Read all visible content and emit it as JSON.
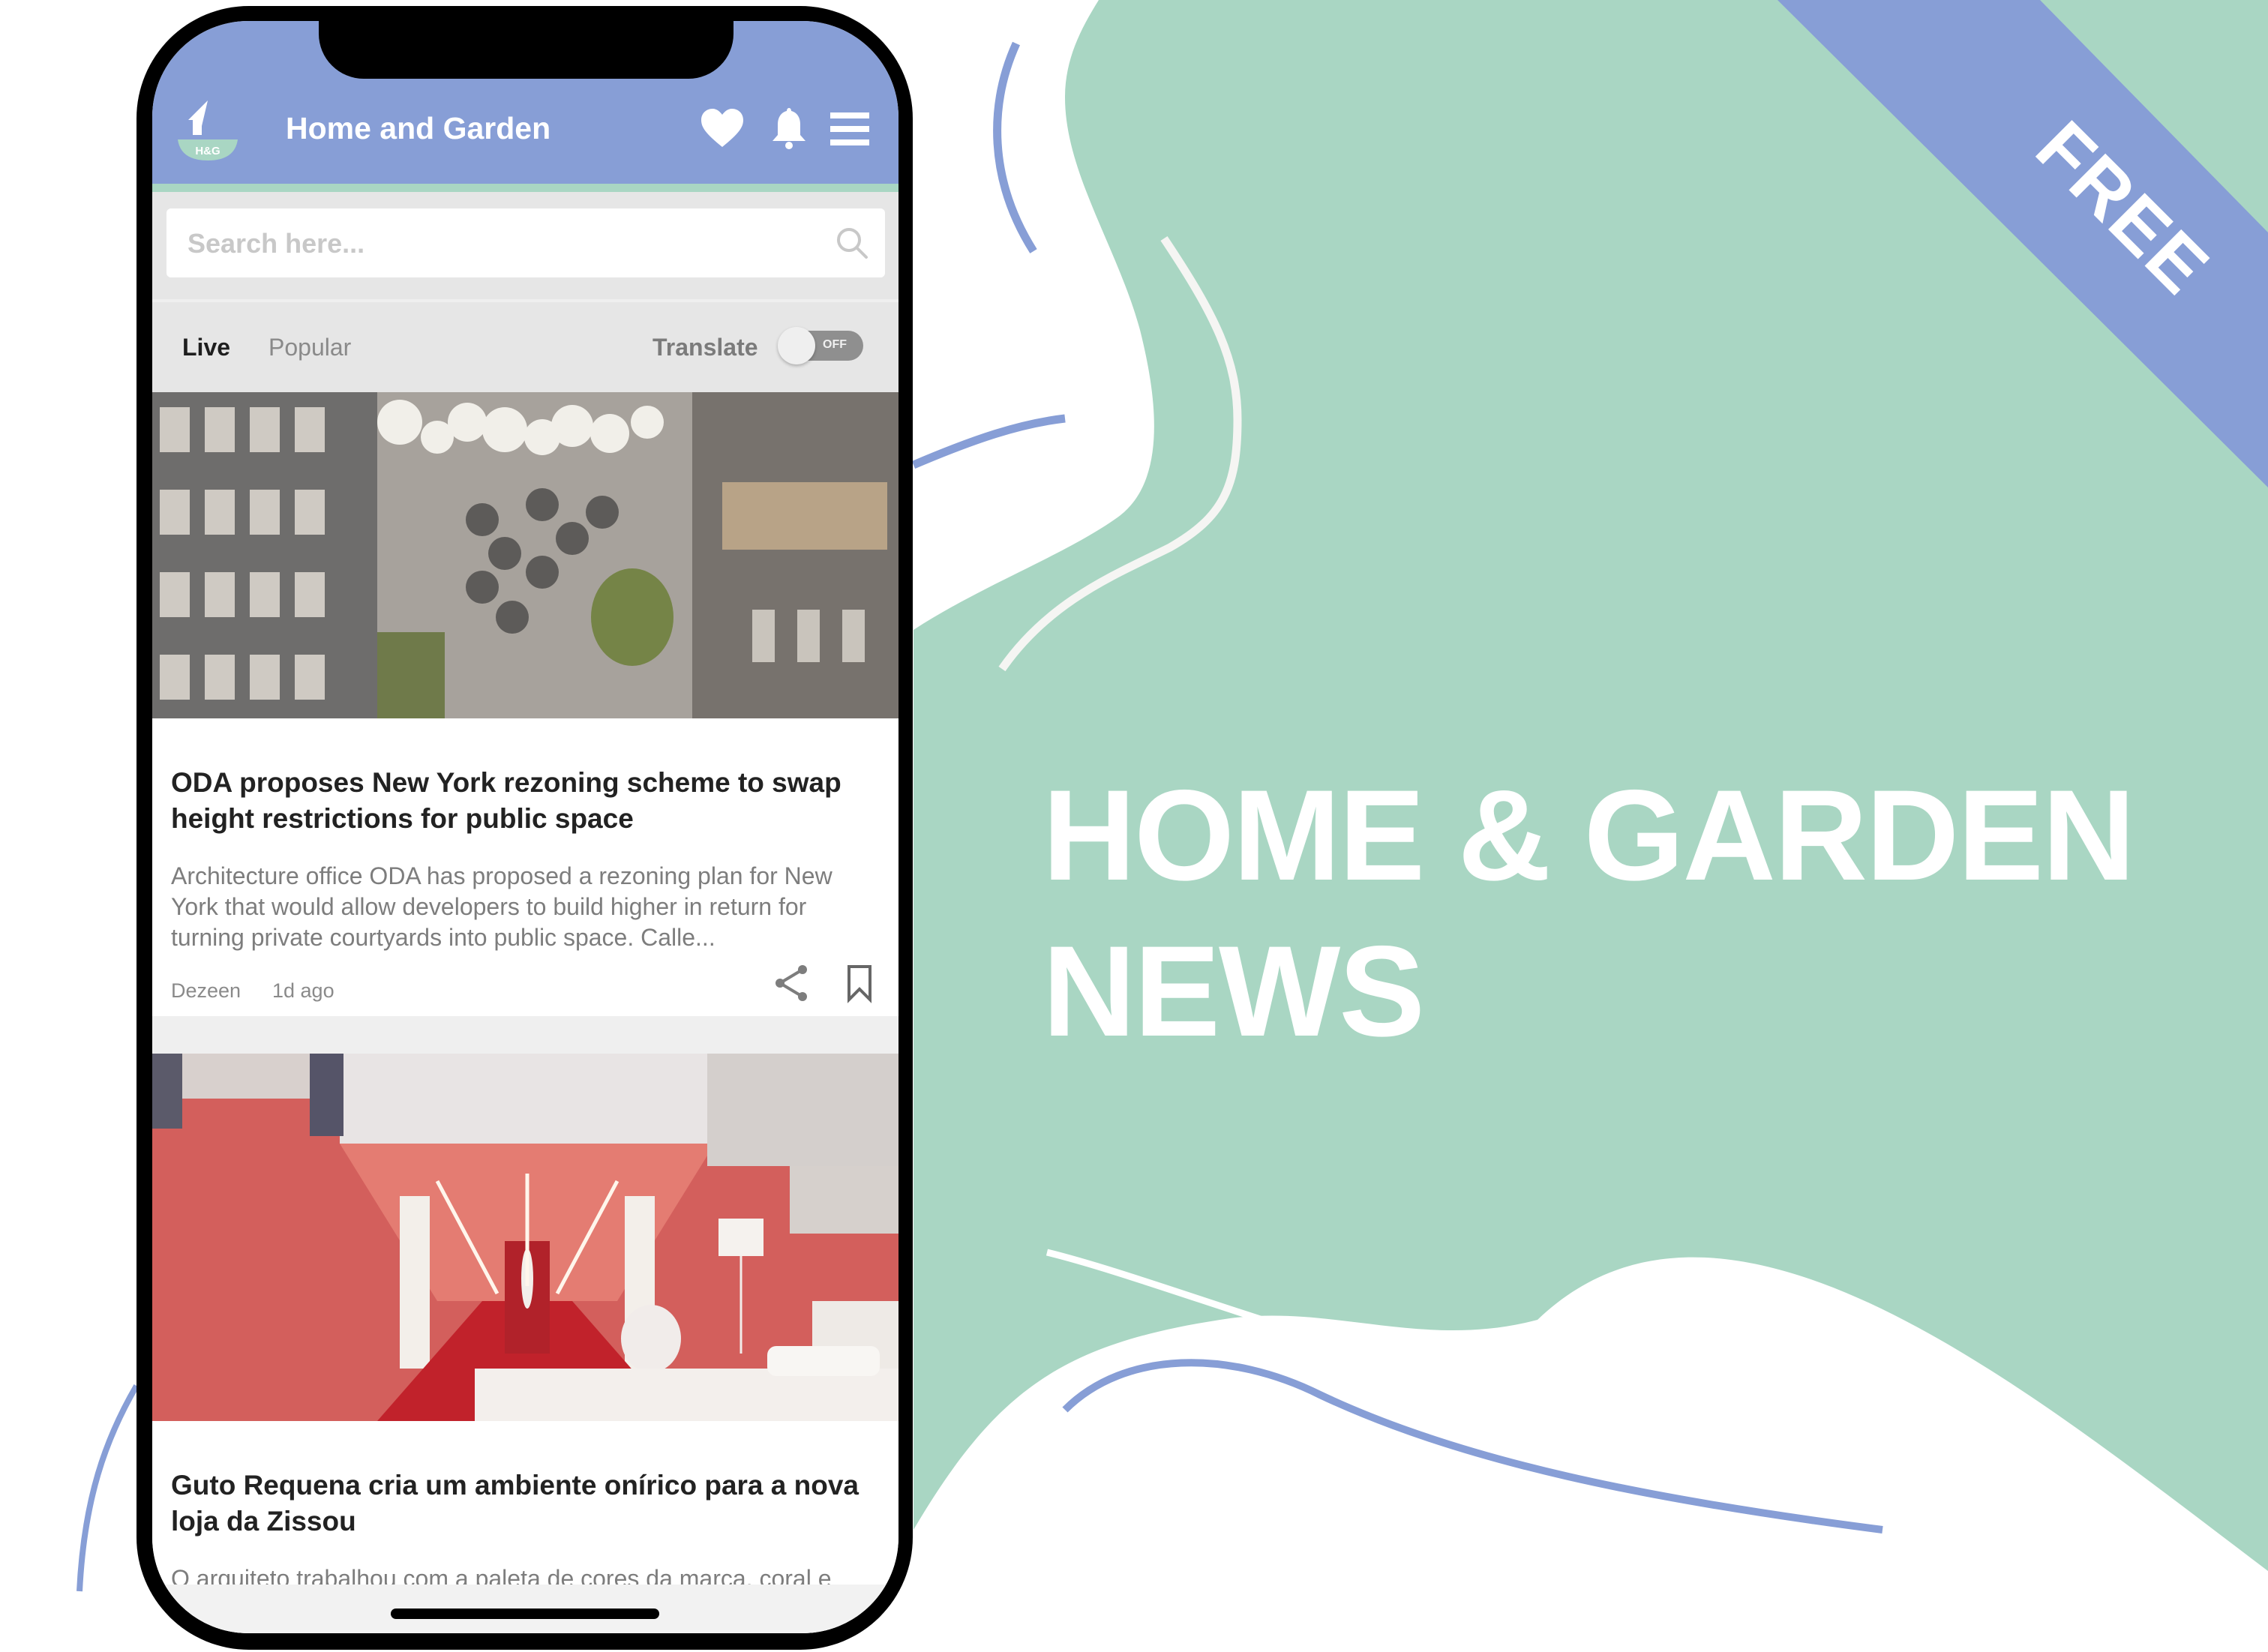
{
  "hero": {
    "title_line1": "HOME & GARDEN",
    "title_line2": "NEWS",
    "ribbon": "FREE"
  },
  "colors": {
    "brand_blue": "#879ED6",
    "mint": "#A9D6C3",
    "background": "#FFFFFF"
  },
  "app": {
    "logo_text": "H&G",
    "title": "Home and Garden",
    "icons": [
      "heart-icon",
      "bell-icon",
      "menu-icon"
    ],
    "search": {
      "placeholder": "Search here...",
      "value": ""
    },
    "tabs": [
      {
        "label": "Live",
        "active": true
      },
      {
        "label": "Popular",
        "active": false
      }
    ],
    "translate": {
      "label": "Translate",
      "state": "OFF"
    },
    "articles": [
      {
        "title": "ODA proposes New York rezoning scheme to swap height restrictions for public space",
        "description": "Architecture office ODA has proposed a rezoning plan for New York that would allow developers to build higher in return for turning private courtyards into public space. Calle...",
        "source": "Dezeen",
        "time": "1d ago",
        "image": "aerial view of courtyard between buildings"
      },
      {
        "title": "Guto Requena cria um ambiente onírico para a nova loja da Zissou",
        "description": "O arquiteto trabalhou com a paleta de cores da marca, coral e azul, e utilizou a caixa de papelão como módulo base do",
        "image": "coral red store interior corridor with staircase"
      }
    ]
  }
}
